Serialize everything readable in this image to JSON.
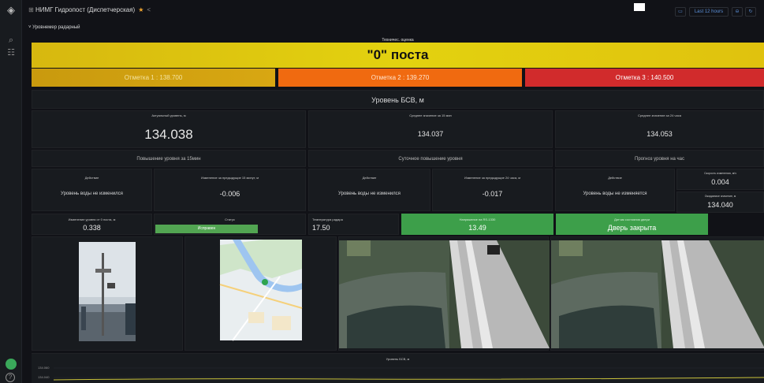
{
  "topbar": {
    "title": "НИМГ Гидропост (Диспетчерская)",
    "star_icon": "star-icon",
    "share_icon": "share-icon",
    "time_picker": "Last 12 hours"
  },
  "row": {
    "title": "Уровнемер радарный"
  },
  "zero_post": {
    "label": "Техничес. оценка",
    "value": "\"0\" поста"
  },
  "marks": [
    {
      "label": "Отметка 1 : 138.700",
      "color": "#d2a511"
    },
    {
      "label": "Отметка 2 : 139.270",
      "color": "#f06a10"
    },
    {
      "label": "Отметка 3 : 140.500",
      "color": "#d12b2c"
    }
  ],
  "bsv_title": "Уровень БСВ, м",
  "stats": [
    {
      "caption": "Актуальный уровень, м",
      "value": "134.038"
    },
    {
      "caption": "Среднее значение за 15 мин",
      "value": "134.037"
    },
    {
      "caption": "Среднее значение за 24 часа",
      "value": "134.053"
    }
  ],
  "section_titles": [
    "Повышение уровня за 15мин",
    "Суточное повышение уровня",
    "Прогноз уровня на час"
  ],
  "cells": [
    {
      "caption": "Действие",
      "text": "Уровень воды не изменился"
    },
    {
      "caption": "Изменение за предыдущие 15 минут, м",
      "value": "-0.006"
    },
    {
      "caption": "Действие",
      "text": "Уровень воды не изменился"
    },
    {
      "caption": "Изменение за предыдущие 24 часа, м",
      "value": "-0.017"
    },
    {
      "caption": "Действие",
      "text": "Уровень воды не изменяется"
    }
  ],
  "forecast": [
    {
      "caption": "Скорость изменения, м/ч",
      "value": "0.004"
    },
    {
      "caption": "Ожидаемое значение, м",
      "value": "134.040"
    }
  ],
  "status_row": [
    {
      "caption": "Изменение уровня от 0 поста, м",
      "value": "0.338"
    },
    {
      "caption": "Статус",
      "value": "Исправен"
    },
    {
      "caption": "Температура радара",
      "value": "17.50"
    },
    {
      "caption": "Напряжение на RS-1330",
      "value": "13.49"
    },
    {
      "caption": "Датчик состояния двери",
      "value": "Дверь закрыта"
    }
  ],
  "graph": {
    "caption": "Уровень БСВ, м",
    "y_ticks": [
      "134.060",
      "134.040"
    ]
  },
  "colors": {
    "accent_yellow": "#e3d20f",
    "status_green": "#3d9f4a",
    "background": "#111217",
    "panel": "#181b1f"
  },
  "icons": {
    "logo": "grafana-logo-icon",
    "search": "search-icon",
    "dashboards": "dashboards-icon",
    "help": "help-icon"
  }
}
